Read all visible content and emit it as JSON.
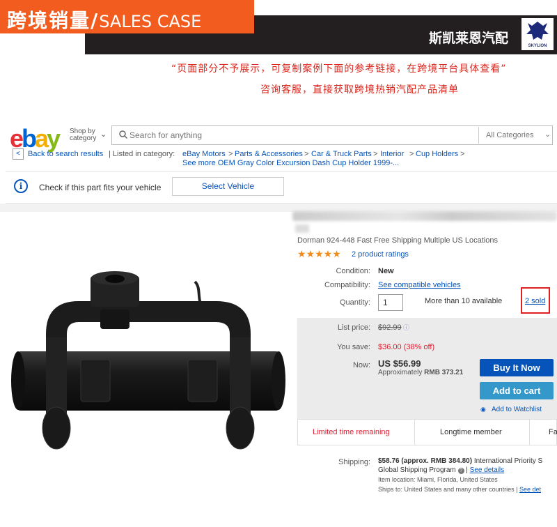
{
  "banner": {
    "title_cn": "跨境销量/",
    "title_en": "SALES CASE",
    "brand": "斯凯莱恩汽配",
    "logo_text": "SKYLION",
    "notice_line1": "“页面部分不予展示，可复制案例下面的参考链接，在跨境平台具体查看”",
    "notice_line2": "咨询客服，直接获取跨境热销汽配产品清单"
  },
  "colors": {
    "banner_orange": "#f25c1f",
    "banner_dark": "#231f20",
    "notice_red": "#d9261c",
    "ebay_link": "#0654ba",
    "buy_now": "#0654ba",
    "add_to_cart": "#3498ca",
    "sold_highlight": "#e02020"
  },
  "header": {
    "logo": {
      "e": "e",
      "b": "b",
      "a": "a",
      "y": "y"
    },
    "shop_by_1": "Shop by",
    "shop_by_2": "category",
    "search_placeholder": "Search for anything",
    "category": "All Categories"
  },
  "breadcrumb": {
    "back": "Back to search results",
    "listed_in": "| Listed in category:",
    "items": [
      "eBay Motors",
      "Parts & Accessories",
      "Car & Truck Parts",
      "Interior",
      "Cup Holders"
    ],
    "see_more": "See more OEM Gray Color Excursion Dash Cup Holder 1999-..."
  },
  "fit": {
    "text": "Check if this part fits your vehicle",
    "button": "Select Vehicle"
  },
  "product": {
    "subtitle": "Dorman 924-448 Fast Free Shipping Multiple US Locations",
    "stars": "★★★★★",
    "ratings": "2 product ratings",
    "condition_label": "Condition:",
    "condition": "New",
    "compat_label": "Compatibility:",
    "compat": "See compatible vehicles",
    "qty_label": "Quantity:",
    "qty": "1",
    "available": "More than 10 available",
    "sold": "2 sold"
  },
  "pricing": {
    "list_label": "List price:",
    "list_price": "$92.99",
    "save_label": "You save:",
    "save": "$36.00 (38% off)",
    "now_label": "Now:",
    "now": "US $56.99",
    "approx_prefix": "Approximately",
    "approx_value": "RMB 373.21",
    "buy_now": "Buy It Now",
    "add_to_cart": "Add to cart",
    "watch": "Add to Watchlist"
  },
  "promo": {
    "item1": "Limited time remaining",
    "item2": "Longtime member",
    "item3": "Fa"
  },
  "shipping": {
    "label": "Shipping:",
    "cost": "$58.76 (approx. RMB 384.80)",
    "method": "International Priority S",
    "program": "Global Shipping Program",
    "see_details": "See details",
    "location": "Item location: Miami, Florida, United States",
    "ships_to": "Ships to: United States and many other countries |",
    "see_det2": "See det"
  }
}
